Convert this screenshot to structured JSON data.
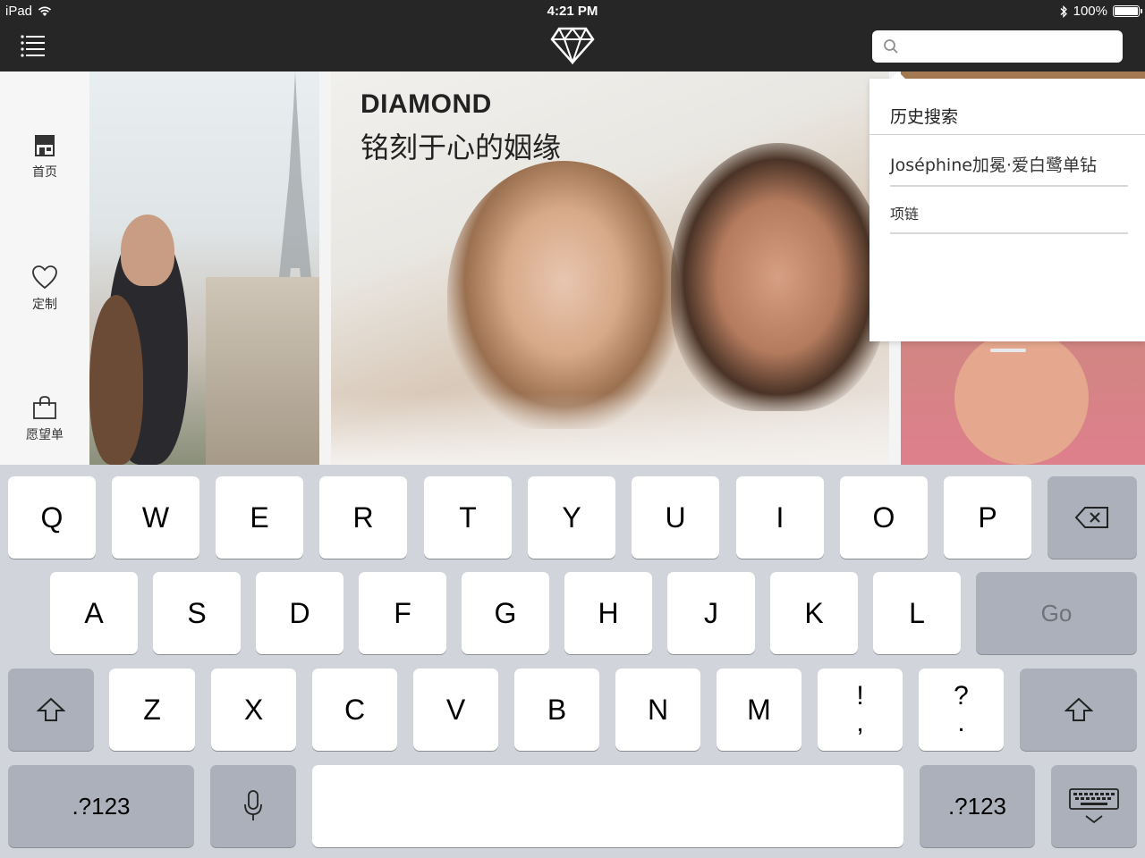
{
  "status_bar": {
    "device": "iPad",
    "time": "4:21 PM",
    "battery": "100%",
    "battery_level": 1.0,
    "icons": [
      "wifi-icon",
      "bluetooth-icon",
      "battery-icon"
    ]
  },
  "nav": {
    "menu_icon": "list-menu-icon",
    "logo_icon": "diamond-icon",
    "search": {
      "value": "",
      "placeholder": "",
      "icon": "search-icon"
    }
  },
  "sidebar": {
    "items": [
      {
        "label": "首页",
        "icon": "store-icon"
      },
      {
        "label": "定制",
        "icon": "heart-icon"
      },
      {
        "label": "愿望单",
        "icon": "shopping-bag-icon"
      }
    ]
  },
  "hero": {
    "title": "DIAMOND",
    "subtitle": "铭刻于心的姻缘"
  },
  "search_history": {
    "heading": "历史搜索",
    "items": [
      "Joséphine加冕·爱白鹭单钻",
      "项链"
    ]
  },
  "keyboard": {
    "row1": [
      "Q",
      "W",
      "E",
      "R",
      "T",
      "Y",
      "U",
      "I",
      "O",
      "P"
    ],
    "row2": [
      "A",
      "S",
      "D",
      "F",
      "G",
      "H",
      "J",
      "K",
      "L"
    ],
    "row3": [
      "Z",
      "X",
      "C",
      "V",
      "B",
      "N",
      "M"
    ],
    "punct1": {
      "top": "!",
      "bottom": ","
    },
    "punct2": {
      "top": "?",
      "bottom": "."
    },
    "go_label": "Go",
    "num_label": ".?123",
    "colors": {
      "background": "#d1d5db",
      "key": "#ffffff",
      "key_special": "#abb0ba"
    }
  },
  "colors": {
    "topbar": "#262626",
    "sidebar": "#f6f6f6"
  }
}
